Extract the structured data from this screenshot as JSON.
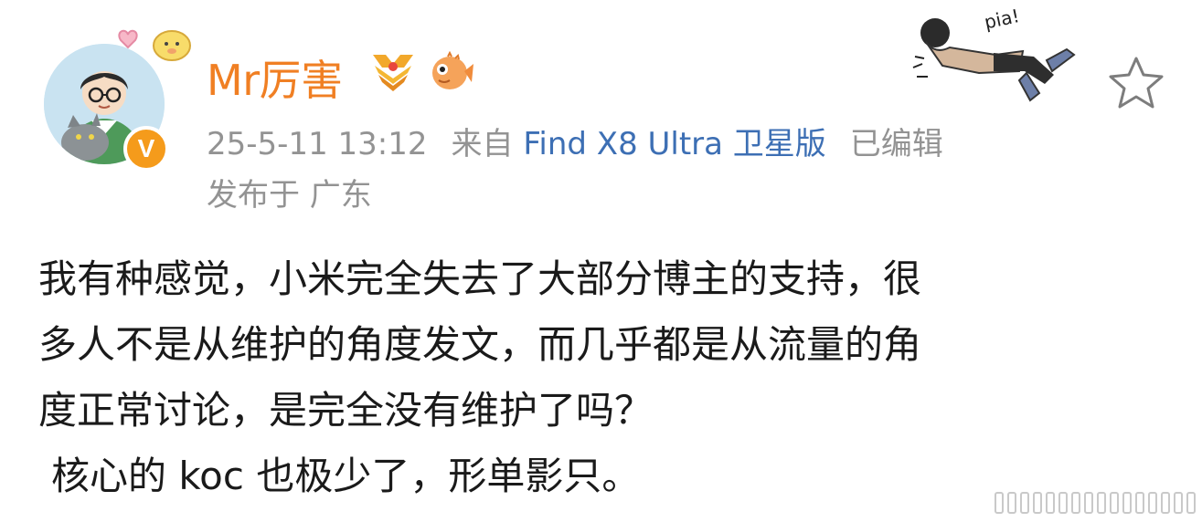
{
  "post": {
    "username": "Mr厉害",
    "timestamp": "25-5-11 13:12",
    "source_prefix": "来自",
    "source_device": "Find X8 Ultra 卫星版",
    "edited_label": "已编辑",
    "location": "发布于 广东",
    "verified_badge_letter": "V",
    "content_lines": [
      "我有种感觉，小米完全失去了大部分博主的支持，很",
      "多人不是从维护的角度发文，而几乎都是从流量的角",
      "度正常讨论，是完全没有维护了吗？"
    ],
    "content_p2": "核心的 koc 也极少了，形单影只。",
    "sticker_text": "pia!"
  },
  "icons": {
    "avatar": "avatar-cartoon-man-with-cat",
    "badge_1": "gold-chevron-medal-icon",
    "badge_2": "pufferfish-icon",
    "favorite": "star-outline-icon",
    "verified": "verified-v-icon"
  },
  "colors": {
    "username": "#f07f23",
    "meta": "#939393",
    "source_link": "#3d6fb4",
    "text": "#1a1a1a",
    "verified": "#f59b1b"
  }
}
